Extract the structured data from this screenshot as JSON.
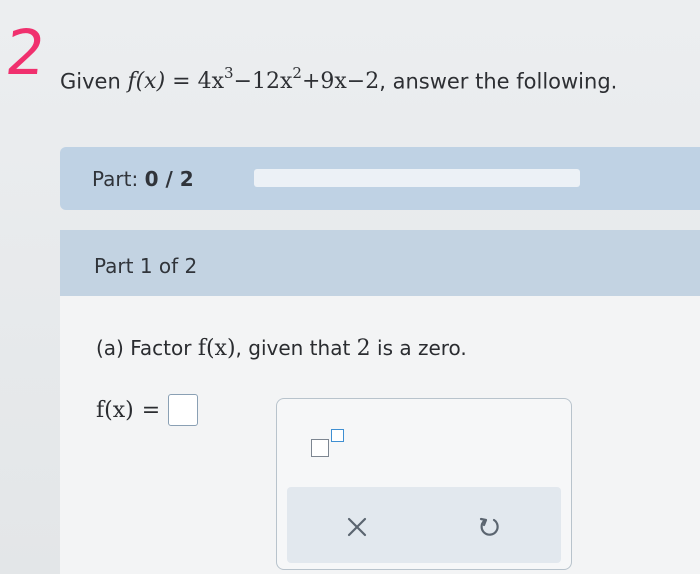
{
  "annotation": {
    "mark": "2"
  },
  "question": {
    "given": "Given",
    "func_lhs": "f(x)",
    "eq": "=",
    "term1_coef": "4x",
    "term1_exp": "3",
    "term2": "−12x",
    "term2_exp": "2",
    "term3": "+9x−2",
    "trailing": ", answer the following."
  },
  "progress": {
    "label": "Part:",
    "value": "0 / 2",
    "completed": 0,
    "total": 2
  },
  "part": {
    "header": "Part 1 of 2",
    "prompt_prefix": "(a) Factor",
    "prompt_func": "f(x)",
    "prompt_mid": ", given that",
    "prompt_zero": "2",
    "prompt_suffix": "is a zero."
  },
  "answer": {
    "lhs": "f(x)",
    "eq": "=",
    "value": ""
  },
  "palette": {
    "exponent_icon": "superscript-template-icon",
    "clear_icon": "x-icon",
    "undo_icon": "undo-icon"
  },
  "colors": {
    "accent": "#4f8ccc",
    "annotation": "#f0306e",
    "part_bar": "#bfd2e4"
  }
}
